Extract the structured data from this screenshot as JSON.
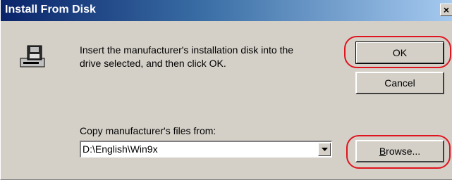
{
  "window": {
    "title": "Install From Disk",
    "close_glyph": "×"
  },
  "message": {
    "line1": "Insert the manufacturer's installation disk into the",
    "line2": "drive selected, and then click OK."
  },
  "buttons": {
    "ok": "OK",
    "cancel": "Cancel",
    "browse_mnemonic": "B",
    "browse_rest": "rowse..."
  },
  "copy_from": {
    "label": "Copy manufacturer's files from:",
    "value": "D:\\English\\Win9x"
  },
  "icons": {
    "disk": "floppy-disk-drive-icon",
    "dropdown": "chevron-down-icon",
    "close": "close-icon"
  },
  "colors": {
    "title_gradient_start": "#0a246a",
    "title_gradient_end": "#a6caf0",
    "dialog_face": "#d4d0c8",
    "highlight": "#e0141e"
  }
}
